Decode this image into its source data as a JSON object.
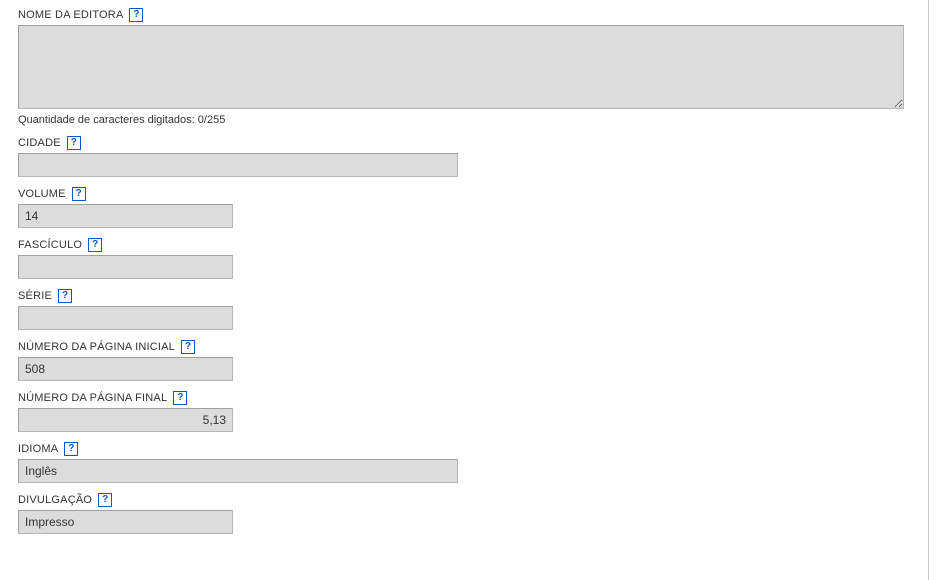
{
  "fields": {
    "editora": {
      "label": "NOME DA EDITORA",
      "value": "",
      "counter": "Quantidade de caracteres digitados: 0/255"
    },
    "cidade": {
      "label": "CIDADE",
      "value": ""
    },
    "volume": {
      "label": "VOLUME",
      "value": "14"
    },
    "fasciculo": {
      "label": "FASCÍCULO",
      "value": ""
    },
    "serie": {
      "label": "SÉRIE",
      "value": ""
    },
    "pagina_inicial": {
      "label": "NÚMERO DA PÁGINA INICIAL",
      "value": "508"
    },
    "pagina_final": {
      "label": "NÚMERO DA PÁGINA FINAL",
      "value": "5,13"
    },
    "idioma": {
      "label": "IDIOMA",
      "value": "Inglês"
    },
    "divulgacao": {
      "label": "DIVULGAÇÃO",
      "value": "Impresso"
    }
  },
  "help_glyph": "?"
}
